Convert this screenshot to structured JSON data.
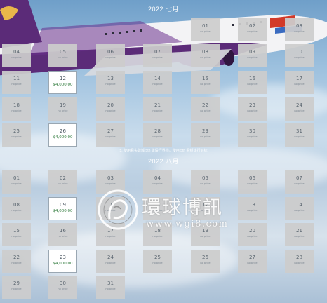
{
  "july": {
    "note": "",
    "title": "2022 七月",
    "unavailable_label": "no price",
    "days": [
      {
        "d": "01",
        "price": ""
      },
      {
        "d": "02",
        "price": ""
      },
      {
        "d": "03",
        "price": ""
      },
      {
        "d": "04",
        "price": ""
      },
      {
        "d": "05",
        "price": ""
      },
      {
        "d": "06",
        "price": ""
      },
      {
        "d": "07",
        "price": ""
      },
      {
        "d": "08",
        "price": ""
      },
      {
        "d": "09",
        "price": ""
      },
      {
        "d": "10",
        "price": ""
      },
      {
        "d": "11",
        "price": ""
      },
      {
        "d": "12",
        "price": "$4,000.00"
      },
      {
        "d": "13",
        "price": ""
      },
      {
        "d": "14",
        "price": ""
      },
      {
        "d": "15",
        "price": ""
      },
      {
        "d": "16",
        "price": ""
      },
      {
        "d": "17",
        "price": ""
      },
      {
        "d": "18",
        "price": ""
      },
      {
        "d": "19",
        "price": ""
      },
      {
        "d": "20",
        "price": ""
      },
      {
        "d": "21",
        "price": ""
      },
      {
        "d": "22",
        "price": ""
      },
      {
        "d": "23",
        "price": ""
      },
      {
        "d": "24",
        "price": ""
      },
      {
        "d": "25",
        "price": ""
      },
      {
        "d": "26",
        "price": "$4,000.00"
      },
      {
        "d": "27",
        "price": ""
      },
      {
        "d": "28",
        "price": ""
      },
      {
        "d": "29",
        "price": ""
      },
      {
        "d": "30",
        "price": ""
      },
      {
        "d": "31",
        "price": ""
      }
    ]
  },
  "august": {
    "note": "5. 使用看头建城 5th 建设行界线。使用 5th 看组建行前标",
    "title": "2022 八月",
    "unavailable_label": "no price",
    "days": [
      {
        "d": "01",
        "price": ""
      },
      {
        "d": "02",
        "price": ""
      },
      {
        "d": "03",
        "price": ""
      },
      {
        "d": "04",
        "price": ""
      },
      {
        "d": "05",
        "price": ""
      },
      {
        "d": "06",
        "price": ""
      },
      {
        "d": "07",
        "price": ""
      },
      {
        "d": "08",
        "price": ""
      },
      {
        "d": "09",
        "price": "$4,000.00"
      },
      {
        "d": "10",
        "price": ""
      },
      {
        "d": "11",
        "price": ""
      },
      {
        "d": "12",
        "price": ""
      },
      {
        "d": "13",
        "price": ""
      },
      {
        "d": "14",
        "price": ""
      },
      {
        "d": "15",
        "price": ""
      },
      {
        "d": "16",
        "price": ""
      },
      {
        "d": "17",
        "price": ""
      },
      {
        "d": "18",
        "price": ""
      },
      {
        "d": "19",
        "price": ""
      },
      {
        "d": "20",
        "price": ""
      },
      {
        "d": "21",
        "price": ""
      },
      {
        "d": "22",
        "price": ""
      },
      {
        "d": "23",
        "price": "$4,000.00"
      },
      {
        "d": "24",
        "price": ""
      },
      {
        "d": "25",
        "price": ""
      },
      {
        "d": "26",
        "price": ""
      },
      {
        "d": "27",
        "price": ""
      },
      {
        "d": "28",
        "price": ""
      },
      {
        "d": "29",
        "price": ""
      },
      {
        "d": "30",
        "price": ""
      },
      {
        "d": "31",
        "price": ""
      }
    ]
  },
  "watermark": {
    "name_cn": "環球博訊",
    "url": "www.wgi8.com"
  },
  "colors": {
    "unavailable_cell": "#cccccc",
    "available_cell": "#ffffff",
    "price_text": "#2f7a3b",
    "plane_livery": "#5b2b78"
  }
}
